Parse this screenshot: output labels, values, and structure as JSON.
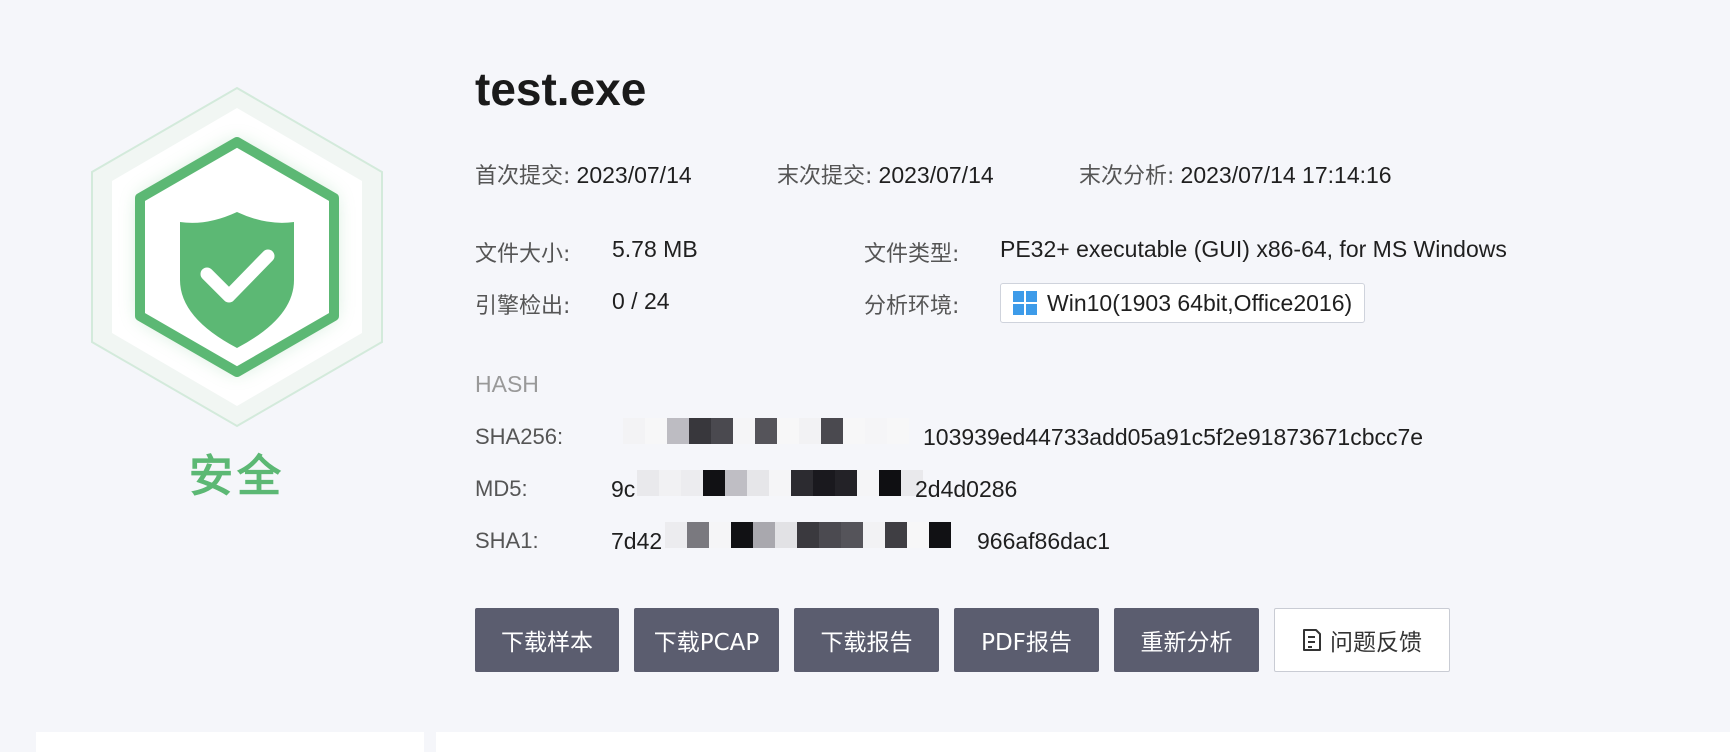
{
  "verdict": {
    "label": "安全",
    "color": "#5cb874",
    "icon": "shield-check-icon"
  },
  "file": {
    "name": "test.exe"
  },
  "dates": {
    "first_submit_label": "首次提交:",
    "first_submit_value": "2023/07/14",
    "last_submit_label": "末次提交:",
    "last_submit_value": "2023/07/14",
    "last_analysis_label": "末次分析:",
    "last_analysis_value": "2023/07/14 17:14:16"
  },
  "meta": {
    "size_label": "文件大小:",
    "size_value": "5.78 MB",
    "type_label": "文件类型:",
    "type_value": "PE32+ executable (GUI) x86-64, for MS Windows",
    "engine_label": "引擎检出:",
    "engine_value": "0 / 24",
    "env_label": "分析环境:",
    "env_value": "Win10(1903 64bit,Office2016)",
    "env_icon": "windows-icon"
  },
  "hash": {
    "title": "HASH",
    "sha256_label": "SHA256:",
    "sha256_visible": "103939ed44733add05a91c5f2e91873671cbcc7e",
    "md5_label": "MD5:",
    "md5_prefix": "9c",
    "md5_suffix": "2d4d0286",
    "sha1_label": "SHA1:",
    "sha1_prefix": "7d42",
    "sha1_suffix": "966af86dac1"
  },
  "actions": {
    "download_sample": "下载样本",
    "download_pcap": "下载PCAP",
    "download_report": "下载报告",
    "pdf_report": "PDF报告",
    "reanalyze": "重新分析",
    "feedback": "问题反馈"
  },
  "colors": {
    "button_bg": "#5b5d6f",
    "accent_green": "#5cb874",
    "windows_blue": "#3d9be9"
  }
}
